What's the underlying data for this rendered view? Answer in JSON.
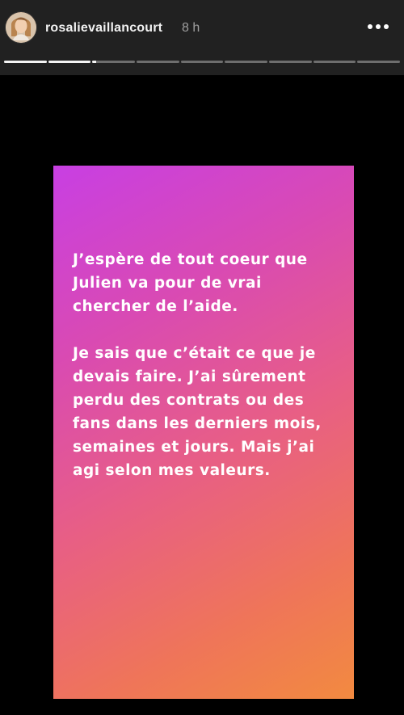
{
  "header": {
    "username": "rosalievaillancourt",
    "time": "8 h",
    "more_icon": "more-horizontal-icon"
  },
  "progress": {
    "segments": [
      1,
      1,
      0.08,
      0,
      0,
      0,
      0,
      0,
      0
    ]
  },
  "story": {
    "paragraphs": [
      "J’espère de tout coeur que Julien va pour de vrai chercher de l’aide.",
      "Je sais que c’était ce que je devais faire. J’ai sûrement perdu des contrats ou des fans dans les derniers mois, semaines et jours. Mais j’ai agi selon mes valeurs."
    ],
    "gradient_colors": [
      "#c83fe3",
      "#d94ab3",
      "#e85f84",
      "#ef7559",
      "#f28a40"
    ]
  },
  "colors": {
    "background": "#000000",
    "header_band": "#212121",
    "username": "#f2f2f2",
    "time": "#9f9f9f"
  }
}
